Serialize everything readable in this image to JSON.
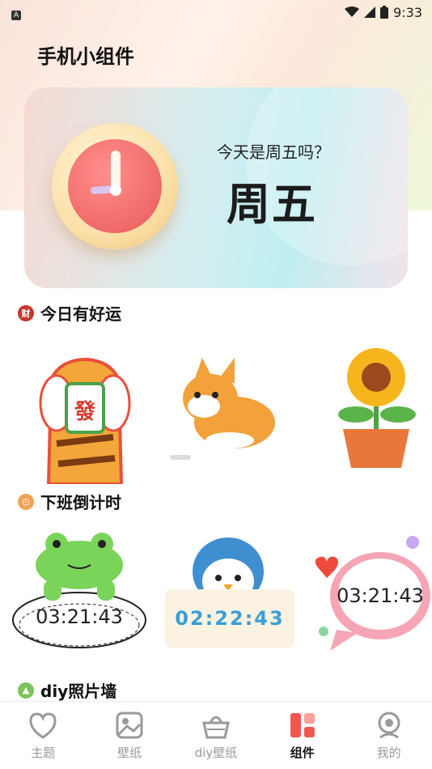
{
  "status_bar": {
    "time": "9:33",
    "left_badge": "A"
  },
  "header": {
    "title": "手机小组件"
  },
  "hero": {
    "question": "今天是周五吗？",
    "answer": "周五"
  },
  "sections": {
    "luck": {
      "title": "今日有好运",
      "icon_text": "财"
    },
    "countdown": {
      "title": "下班倒计时"
    },
    "photo_wall": {
      "title": "diy照片墙"
    }
  },
  "luck_sticker_text": "發",
  "timers": [
    "03:21:43",
    "02:22:43",
    "03:21:43"
  ],
  "tabs": [
    {
      "label": "主题",
      "icon": "heart-icon",
      "active": false
    },
    {
      "label": "壁纸",
      "icon": "image-icon",
      "active": false
    },
    {
      "label": "diy壁纸",
      "icon": "basket-icon",
      "active": false
    },
    {
      "label": "组件",
      "icon": "widget-icon",
      "active": true
    },
    {
      "label": "我的",
      "icon": "profile-icon",
      "active": false
    }
  ],
  "colors": {
    "accent": "#f0584f",
    "tab_inactive": "#9a9a9a",
    "timer_blue": "#3a9fd6"
  }
}
